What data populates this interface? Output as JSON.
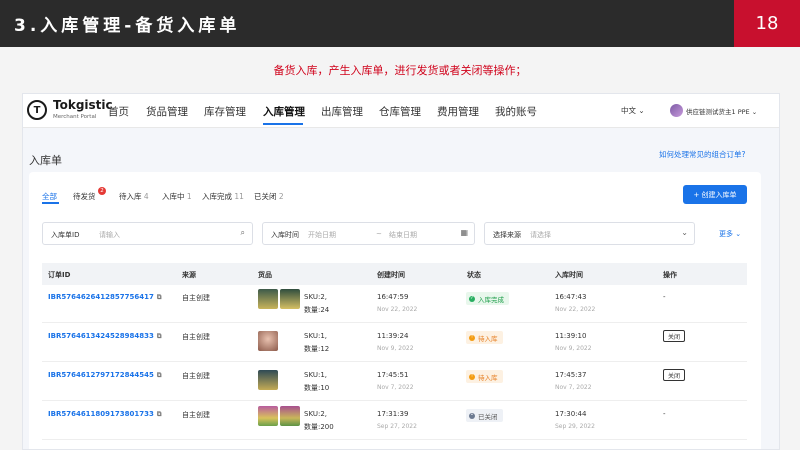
{
  "slide": {
    "title": "3.入库管理-备货入库单",
    "page_number": "18",
    "subtitle": "备货入库，产生入库单，进行发货或者关闭等操作；",
    "accent_color": "#c8102e"
  },
  "app": {
    "logo": {
      "name": "Tokgistic",
      "sub": "Merchant Portal",
      "icon": "tokgistic-logo-icon"
    },
    "nav": [
      "首页",
      "货品管理",
      "库存管理",
      "入库管理",
      "出库管理",
      "仓库管理",
      "费用管理",
      "我的账号"
    ],
    "active_nav": "入库管理",
    "language": "中文",
    "user": "供应链测试货主1 PPE",
    "page_title": "入库单",
    "help_link": "如何处理常见的组合订单?",
    "tabs": [
      {
        "label": "全部",
        "count": ""
      },
      {
        "label": "待发货",
        "count": ""
      },
      {
        "label": "待入库",
        "count": "4"
      },
      {
        "label": "入库中",
        "count": "1"
      },
      {
        "label": "入库完成",
        "count": "11"
      },
      {
        "label": "已关闭",
        "count": "2"
      }
    ],
    "pending_badge": "2",
    "create_button": "+ 创建入库单",
    "filters": {
      "order_label": "入库单ID",
      "order_placeholder": "请输入",
      "time_label": "入库时间",
      "start_placeholder": "开始日期",
      "range_sep": "~",
      "end_placeholder": "结束日期",
      "source_label": "选择来源",
      "source_placeholder": "请选择",
      "more": "更多"
    },
    "columns": [
      "订单ID",
      "来源",
      "货品",
      "创建时间",
      "状态",
      "入库时间",
      "操作"
    ],
    "rows": [
      {
        "id": "IBR5764626412857756417",
        "source": "自主创建",
        "sku": "SKU:2,",
        "qty": "数量:24",
        "created_time": "16:47:59",
        "created_date": "Nov 22, 2022",
        "status": "入库完成",
        "in_time": "16:47:43",
        "in_date": "Nov 22, 2022",
        "action": "-"
      },
      {
        "id": "IBR5764613424528984833",
        "source": "自主创建",
        "sku": "SKU:1,",
        "qty": "数量:12",
        "created_time": "11:39:24",
        "created_date": "Nov 9, 2022",
        "status": "待入库",
        "in_time": "11:39:10",
        "in_date": "Nov 9, 2022",
        "action": "关闭"
      },
      {
        "id": "IBR5764612797172844545",
        "source": "自主创建",
        "sku": "SKU:1,",
        "qty": "数量:10",
        "created_time": "17:45:51",
        "created_date": "Nov 7, 2022",
        "status": "待入库",
        "in_time": "17:45:37",
        "in_date": "Nov 7, 2022",
        "action": "关闭"
      },
      {
        "id": "IBR5764611809173801733",
        "source": "自主创建",
        "sku": "SKU:2,",
        "qty": "数量:200",
        "created_time": "17:31:39",
        "created_date": "Sep 27, 2022",
        "status": "已关闭",
        "in_time": "17:30:44",
        "in_date": "Sep 29, 2022",
        "action": "-"
      }
    ]
  }
}
